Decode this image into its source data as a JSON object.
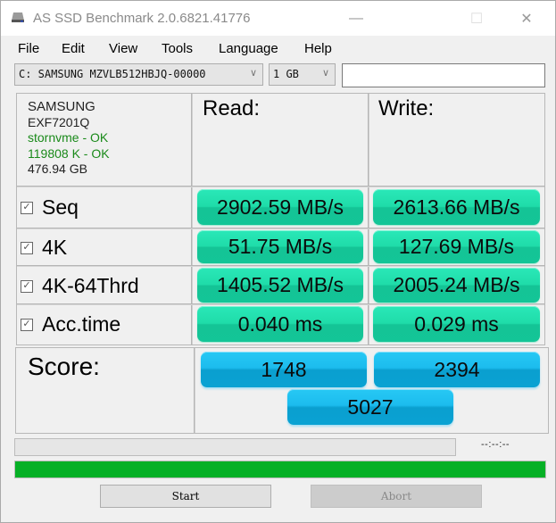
{
  "window": {
    "title": "AS SSD Benchmark 2.0.6821.41776",
    "icon": "drive-icon",
    "controls": {
      "minimize": "—",
      "maximize": "☐",
      "close": "✕"
    }
  },
  "menu": [
    "File",
    "Edit",
    "View",
    "Tools",
    "Language",
    "Help"
  ],
  "toolbar": {
    "drive_selected": "C: SAMSUNG MZVLB512HBJQ-00000",
    "size_selected": "1 GB",
    "text_value": ""
  },
  "drive_info": {
    "vendor": "SAMSUNG",
    "firmware": "EXF7201Q",
    "driver_status": "stornvme - OK",
    "alignment_status": "119808 K - OK",
    "capacity": "476.94 GB"
  },
  "columns": {
    "read": "Read:",
    "write": "Write:"
  },
  "tests": [
    {
      "label": "Seq",
      "checked": true,
      "read": "2902.59 MB/s",
      "write": "2613.66 MB/s"
    },
    {
      "label": "4K",
      "checked": true,
      "read": "51.75 MB/s",
      "write": "127.69 MB/s"
    },
    {
      "label": "4K-64Thrd",
      "checked": true,
      "read": "1405.52 MB/s",
      "write": "2005.24 MB/s"
    },
    {
      "label": "Acc.time",
      "checked": true,
      "read": "0.040 ms",
      "write": "0.029 ms"
    }
  ],
  "score": {
    "label": "Score:",
    "read": "1748",
    "write": "2394",
    "total": "5027"
  },
  "progress": {
    "test_progress": 0,
    "elapsed_time": "--:--:--",
    "overall_progress": 100
  },
  "buttons": {
    "start": "Start",
    "abort": "Abort"
  },
  "colors": {
    "result_green": "#1fdca9",
    "score_blue": "#1cbcee",
    "progress_green": "#06b026",
    "status_ok": "#1a8a1a"
  }
}
